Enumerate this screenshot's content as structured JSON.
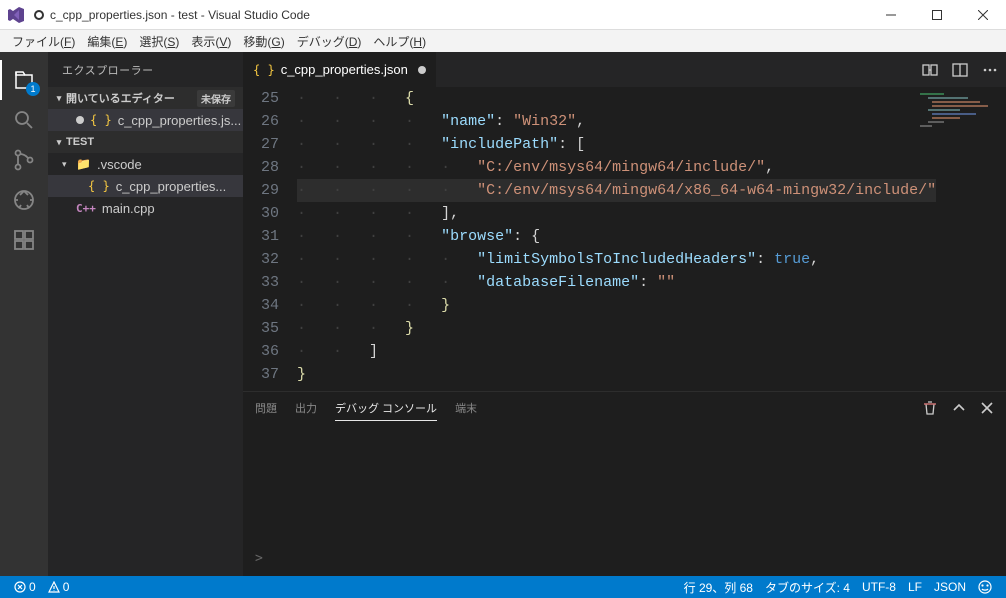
{
  "window": {
    "title": "c_cpp_properties.json - test - Visual Studio Code"
  },
  "menubar": {
    "items": [
      {
        "label": "ファイル",
        "hotkey": "F"
      },
      {
        "label": "編集",
        "hotkey": "E"
      },
      {
        "label": "選択",
        "hotkey": "S"
      },
      {
        "label": "表示",
        "hotkey": "V"
      },
      {
        "label": "移動",
        "hotkey": "G"
      },
      {
        "label": "デバッグ",
        "hotkey": "D"
      },
      {
        "label": "ヘルプ",
        "hotkey": "H"
      }
    ]
  },
  "activitybar": {
    "explorer_badge": "1"
  },
  "sidebar": {
    "title": "エクスプローラー",
    "open_editors_label": "開いているエディター",
    "unsaved_label": "未保存",
    "open_editors": [
      {
        "name": "c_cpp_properties.js...",
        "dirty": true
      }
    ],
    "workspace_name": "TEST",
    "tree": {
      "vscode_folder": ".vscode",
      "properties_file": "c_cpp_properties...",
      "main_file": "main.cpp"
    }
  },
  "tabs": {
    "active": {
      "name": "c_cpp_properties.json",
      "dirty": true
    }
  },
  "editor": {
    "lines": [
      {
        "num": 25,
        "indent": 3,
        "tokens": [
          {
            "t": "brace",
            "v": "{"
          }
        ]
      },
      {
        "num": 26,
        "indent": 4,
        "tokens": [
          {
            "t": "key",
            "v": "\"name\""
          },
          {
            "t": "punc",
            "v": ": "
          },
          {
            "t": "str",
            "v": "\"Win32\""
          },
          {
            "t": "punc",
            "v": ","
          }
        ]
      },
      {
        "num": 27,
        "indent": 4,
        "tokens": [
          {
            "t": "key",
            "v": "\"includePath\""
          },
          {
            "t": "punc",
            "v": ": ["
          }
        ]
      },
      {
        "num": 28,
        "indent": 5,
        "tokens": [
          {
            "t": "str",
            "v": "\"C:/env/msys64/mingw64/include/\""
          },
          {
            "t": "punc",
            "v": ","
          }
        ]
      },
      {
        "num": 29,
        "indent": 5,
        "highlight": true,
        "tokens": [
          {
            "t": "str",
            "v": "\"C:/env/msys64/mingw64/x86_64-w64-mingw32/include/\""
          }
        ]
      },
      {
        "num": 30,
        "indent": 4,
        "tokens": [
          {
            "t": "punc",
            "v": "],"
          }
        ]
      },
      {
        "num": 31,
        "indent": 4,
        "tokens": [
          {
            "t": "key",
            "v": "\"browse\""
          },
          {
            "t": "punc",
            "v": ": {"
          }
        ]
      },
      {
        "num": 32,
        "indent": 5,
        "tokens": [
          {
            "t": "key",
            "v": "\"limitSymbolsToIncludedHeaders\""
          },
          {
            "t": "punc",
            "v": ": "
          },
          {
            "t": "bool",
            "v": "true"
          },
          {
            "t": "punc",
            "v": ","
          }
        ]
      },
      {
        "num": 33,
        "indent": 5,
        "tokens": [
          {
            "t": "key",
            "v": "\"databaseFilename\""
          },
          {
            "t": "punc",
            "v": ": "
          },
          {
            "t": "str",
            "v": "\"\""
          }
        ]
      },
      {
        "num": 34,
        "indent": 4,
        "tokens": [
          {
            "t": "brace",
            "v": "}"
          }
        ]
      },
      {
        "num": 35,
        "indent": 3,
        "tokens": [
          {
            "t": "brace",
            "v": "}"
          }
        ]
      },
      {
        "num": 36,
        "indent": 2,
        "tokens": [
          {
            "t": "punc",
            "v": "]"
          }
        ]
      },
      {
        "num": 37,
        "indent": 0,
        "tokens": [
          {
            "t": "brace",
            "v": "}"
          }
        ]
      }
    ]
  },
  "panel": {
    "tabs": {
      "problems": "問題",
      "output": "出力",
      "debug_console": "デバッグ コンソール",
      "terminal": "端末"
    },
    "prompt": ">"
  },
  "statusbar": {
    "errors": "0",
    "warnings": "0",
    "cursor": "行 29、列 68",
    "tab_size": "タブのサイズ: 4",
    "encoding": "UTF-8",
    "eol": "LF",
    "language": "JSON"
  }
}
